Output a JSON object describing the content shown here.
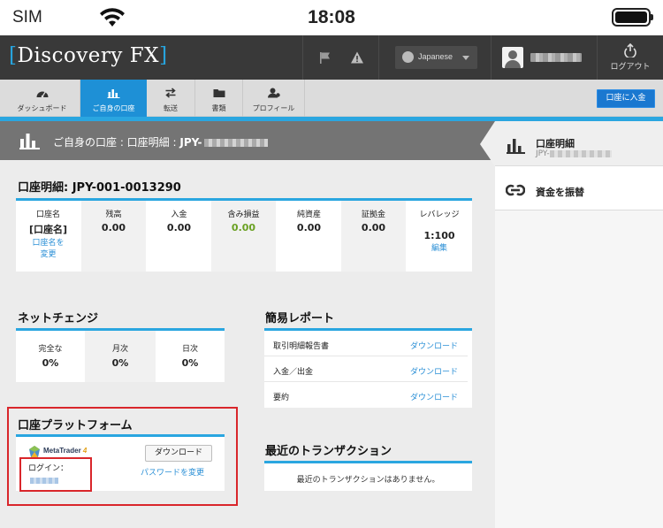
{
  "status_bar": {
    "carrier": "SIM",
    "time": "18:08"
  },
  "header": {
    "logo_open": "[",
    "logo_text": "Discovery FX",
    "logo_close": "]",
    "language": "Japanese",
    "logout_label": "ログアウト"
  },
  "nav": {
    "items": [
      {
        "label": "ダッシュボード",
        "icon": "dashboard-icon"
      },
      {
        "label": "ご自身の口座",
        "icon": "bar-chart-icon",
        "active": true
      },
      {
        "label": "転送",
        "icon": "transfer-icon"
      },
      {
        "label": "書類",
        "icon": "folder-icon"
      },
      {
        "label": "プロフィール",
        "icon": "profile-icon"
      }
    ],
    "deposit_button": "口座に入金"
  },
  "page_title": {
    "prefix": "ご自身の口座 : 口座明細 : ",
    "account": "JPY-"
  },
  "account_details": {
    "title": "口座明細: JPY-001-0013290",
    "cells": [
      {
        "label": "口座名",
        "value": "[口座名]",
        "link": "口座名を変更"
      },
      {
        "label": "残高",
        "value": "0.00"
      },
      {
        "label": "入金",
        "value": "0.00"
      },
      {
        "label": "含み損益",
        "value": "0.00"
      },
      {
        "label": "純資産",
        "value": "0.00"
      },
      {
        "label": "証拠金",
        "value": "0.00"
      },
      {
        "label": "レバレッジ",
        "value": "1:100",
        "link": "編集"
      }
    ]
  },
  "net_change": {
    "title": "ネットチェンジ",
    "cells": [
      {
        "label": "完全な",
        "value": "0%"
      },
      {
        "label": "月次",
        "value": "0%"
      },
      {
        "label": "日次",
        "value": "0%"
      }
    ]
  },
  "quick_report": {
    "title": "簡易レポート",
    "rows": [
      {
        "label": "取引明細報告書",
        "action": "ダウンロード"
      },
      {
        "label": "入金／出金",
        "action": "ダウンロード"
      },
      {
        "label": "要約",
        "action": "ダウンロード"
      }
    ]
  },
  "platform": {
    "title": "口座プラットフォーム",
    "metatrader_label": "MetaTrader",
    "metatrader_version": "4",
    "login_label": "ログイン：",
    "download_button": "ダウンロード",
    "change_password": "パスワードを変更"
  },
  "recent_transactions": {
    "title": "最近のトランザクション",
    "empty_message": "最近のトランザクションはありません。"
  },
  "right_panel": {
    "active_title": "口座明細",
    "active_sub": "JPY-",
    "transfer_label": "資金を振替"
  },
  "colors": {
    "accent": "#2aa6e0",
    "header_bg": "#393939",
    "nav_active": "#1e90d6",
    "link": "#2a8fd6",
    "positive": "#6aa122",
    "highlight": "#d9262b"
  }
}
